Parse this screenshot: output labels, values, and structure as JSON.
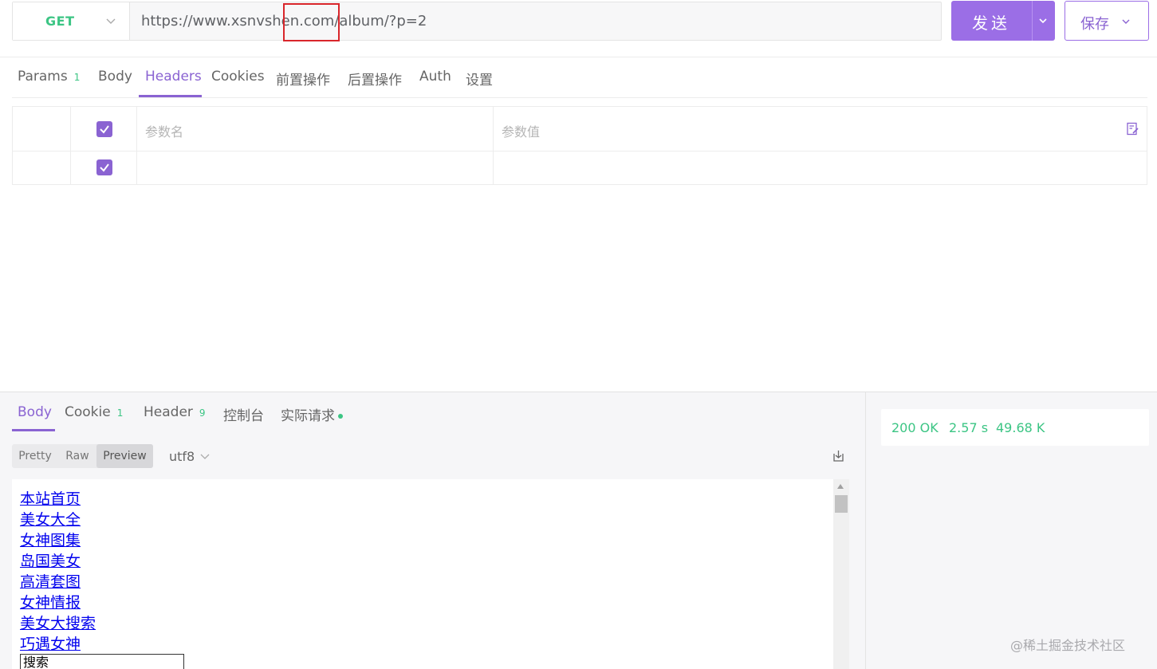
{
  "request": {
    "method": "GET",
    "url": "https://www.xsnvshen.com/album/?p=2",
    "send_label": "发送",
    "save_label": "保存"
  },
  "request_tabs": [
    {
      "label": "Params",
      "badge": "1"
    },
    {
      "label": "Body"
    },
    {
      "label": "Headers",
      "active": true
    },
    {
      "label": "Cookies"
    },
    {
      "label": "前置操作"
    },
    {
      "label": "后置操作"
    },
    {
      "label": "Auth"
    },
    {
      "label": "设置"
    }
  ],
  "headers_table": {
    "name_placeholder": "参数名",
    "value_placeholder": "参数值"
  },
  "response": {
    "tabs": [
      {
        "label": "Body",
        "active": true
      },
      {
        "label": "Cookie",
        "badge": "1"
      },
      {
        "label": "Header",
        "badge": "9"
      },
      {
        "label": "控制台"
      },
      {
        "label": "实际请求"
      }
    ],
    "view_modes": [
      "Pretty",
      "Raw",
      "Preview"
    ],
    "active_view": "Preview",
    "encoding": "utf8",
    "preview_links": [
      "本站首页",
      "美女大全",
      "女神图集",
      "岛国美女",
      "高清套图",
      "女神情报",
      "美女大搜索",
      "巧遇女神"
    ],
    "search_value": "搜索",
    "status": "200 OK",
    "time": "2.57 s",
    "size": "49.68 K"
  },
  "watermark": "@稀土掘金技术社区",
  "colors": {
    "accent": "#9b6ee6",
    "success": "#3cc584",
    "highlight": "#d9262b"
  }
}
